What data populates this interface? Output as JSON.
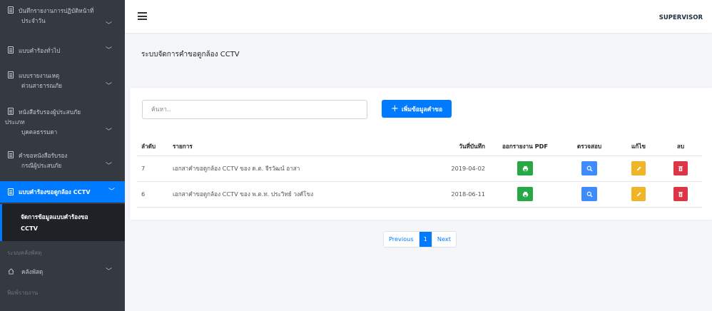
{
  "sidebar": {
    "items": [
      {
        "line1": "บันทึกรายงานการปฏิบัติหน้าที่",
        "line2": "ประจำวัน"
      },
      {
        "line1": "แบบคำร้องทั่วไป"
      },
      {
        "line1": "แบบรายงานเหตุ",
        "line2": "ด่วนสาธารณภัย"
      },
      {
        "line1": "หนังสือรับรองผู้ประสบภัย",
        "line1b": "ประเภท",
        "line2": "บุคคลธรรมดา"
      },
      {
        "line1": "คำขอหนังสือรับรอง",
        "line2": "กรณีผู้ประสบภัย"
      },
      {
        "line1": "แบบคำร้องขอดูกล้อง CCTV"
      }
    ],
    "sub_active": {
      "line1": "จัดการข้อมูลแบบคำร้องขอ",
      "line2": "CCTV"
    },
    "header1": "ระบบคลังพัสดุ",
    "store_item": "คลังพัสดุ",
    "header2": "พิมพ์รายงาน"
  },
  "topbar": {
    "user": "SUPERVISOR"
  },
  "page_title": "ระบบจัดการคำขอดูกล้อง CCTV",
  "search": {
    "placeholder": "ค้นหา.."
  },
  "add_button": {
    "label": "เพิ่มข้อมูลคำขอ"
  },
  "table": {
    "headers": [
      "ลำดับ",
      "รายการ",
      "วันที่บันทึก",
      "ออกรายงาน PDF",
      "ตรวจสอบ",
      "แก้ไข",
      "ลบ"
    ],
    "rows": [
      {
        "no": "7",
        "title": "เอกสาคำขอดูกล้อง CCTV ของ ด.ต. จีรวัฒน์ อาสา",
        "date": "2019-04-02"
      },
      {
        "no": "6",
        "title": "เอกสาคำขอดูกล้อง CCTV ของ พ.ต.ท. ประวิทย์ วงศ์โขง",
        "date": "2018-06-11"
      }
    ]
  },
  "pagination": {
    "prev": "Previous",
    "current": "1",
    "next": "Next"
  },
  "colors": {
    "sidebar": "#343a40",
    "primary": "#007bff",
    "pdf": "#28a745",
    "view": "#3d8bfd",
    "edit": "#f0b429",
    "delete": "#dc3545"
  },
  "icons": {
    "pdf": "printer-icon",
    "view": "search-icon",
    "edit": "pencil-icon",
    "delete": "trash-icon",
    "menu": "hamburger-icon"
  }
}
